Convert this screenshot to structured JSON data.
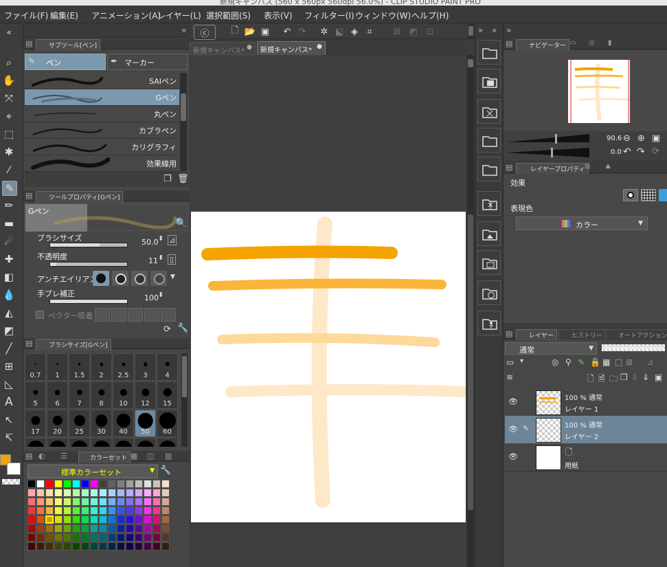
{
  "window": {
    "title": "新規キャンバス (560 x 560px 560dpi 56.0%) - CLIP STUDIO PAINT PRO"
  },
  "menu": [
    "ファイル(F)",
    "編集(E)",
    "アニメーション(A)",
    "レイヤー(L)",
    "選択範囲(S)",
    "表示(V)",
    "フィルター(I)",
    "ウィンドウ(W)",
    "ヘルプ(H)"
  ],
  "subtool": {
    "tab_label": "サブツール[ペン]",
    "groups": [
      "ペン",
      "マーカー"
    ],
    "brushes": [
      "SAIペン",
      "Gペン",
      "丸ペン",
      "カブラペン",
      "カリグラフィ",
      "効果線用"
    ],
    "selected_brush": "Gペン"
  },
  "tool_property": {
    "tab_label": "ツールプロパティ[Gペン]",
    "preview_label": "Gペン",
    "brush_size_label": "ブラシサイズ",
    "brush_size_value": "50.0",
    "opacity_label": "不透明度",
    "opacity_value": "11",
    "antialias_label": "アンチエイリアス",
    "stabilization_label": "手ブレ補正",
    "stabilization_value": "100",
    "vector_snap_label": "ベクター吸着"
  },
  "brush_size_panel": {
    "tab_label": "ブラシサイズ[Gペン]",
    "sizes": [
      "0.7",
      "1",
      "1.5",
      "2",
      "2.5",
      "3",
      "4",
      "5",
      "6",
      "7",
      "8",
      "10",
      "12",
      "15",
      "17",
      "20",
      "25",
      "30",
      "40",
      "50",
      "60"
    ],
    "selected": "50"
  },
  "color_set": {
    "tab_label": "カラーセット",
    "set_name": "標準カラーセット"
  },
  "colors": {
    "main": "#f5a300",
    "sub": "#ffffff",
    "accent_selected": "#7c98ad",
    "stroke1": "#f5a300",
    "stroke2": "#fbb43a",
    "stroke3": "#fdd99a",
    "stroke4": "#fde8c8"
  },
  "canvas_tabs": [
    "新規キャンバス*",
    "新規キャンバス*"
  ],
  "navigator": {
    "tab_label": "ナビゲーター",
    "zoom": "90.6",
    "rotation": "0.0"
  },
  "layer_property": {
    "tab_label": "レイヤープロパティ",
    "effect_label": "効果",
    "expression_label": "表現色",
    "expression_value": "カラー"
  },
  "layer_panel": {
    "tabs": [
      "レイヤー",
      "ヒストリー",
      "オートアクション"
    ],
    "blend_mode": "通常",
    "layers": [
      {
        "line1": "100 % 通常",
        "line2": "レイヤー 1"
      },
      {
        "line1": "100 % 通常",
        "line2": "レイヤー 2"
      },
      {
        "line1": "",
        "line2": "用紙"
      }
    ]
  }
}
